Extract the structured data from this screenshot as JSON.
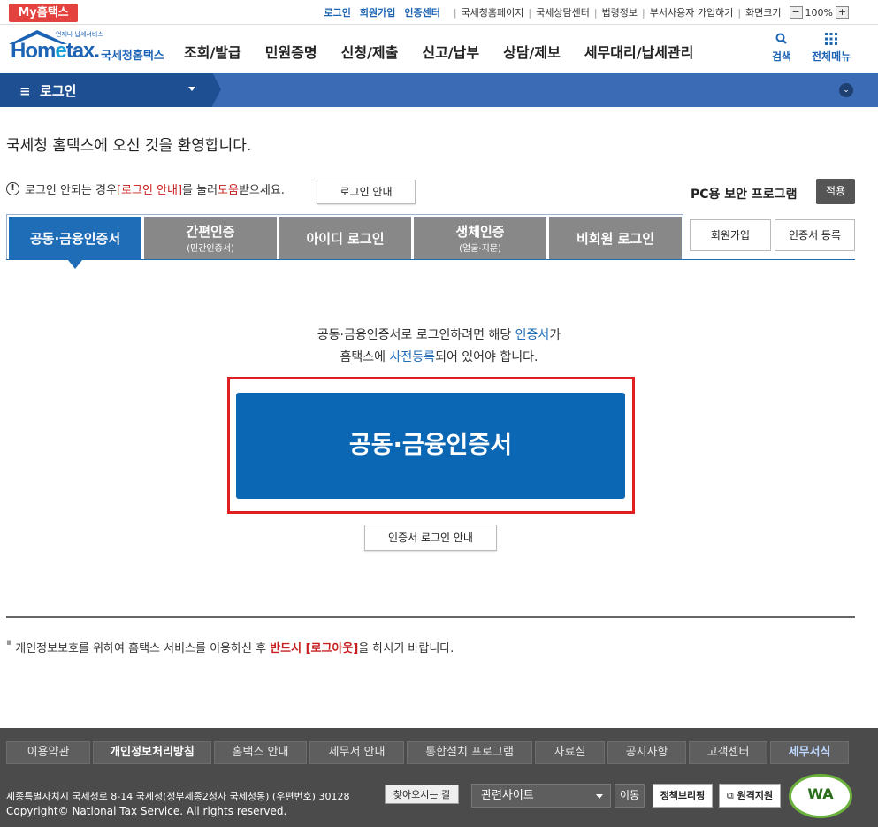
{
  "topbar": {
    "my_hometax": "My홈택스",
    "login": "로그인",
    "join": "회원가입",
    "cert_center": "인증센터",
    "links": [
      "국세청홈페이지",
      "국세상담센터",
      "법령정보",
      "부서사용자 가입하기"
    ],
    "screen_size_label": "화면크기",
    "zoom_minus": "−",
    "zoom_value": "100%",
    "zoom_plus": "+"
  },
  "header": {
    "logo_sub": "언제나 납세서비스",
    "logo_main_a": "Hom",
    "logo_main_e": "e",
    "logo_main_b": "tax.",
    "logo_kr": "국세청홈택스",
    "gnb": [
      "조회/발급",
      "민원증명",
      "신청/제출",
      "신고/납부",
      "상담/제보",
      "세무대리/납세관리"
    ],
    "search_label": "검색",
    "allmenu_label": "전체메뉴"
  },
  "navbar": {
    "menu_icon": "≡",
    "current": "로그인",
    "expand_icon": "⌄"
  },
  "main": {
    "welcome": "국세청 홈택스에 오신 것을 환영합니다.",
    "notice_a": "로그인 안되는 경우 ",
    "notice_b": "[로그인 안내]",
    "notice_c": "를 눌러 ",
    "notice_d": "도움",
    "notice_e": "받으세요.",
    "guide_button": "로그인 안내",
    "pc_security": "PC용 보안 프로그램",
    "apply_button": "적용",
    "tabs": [
      {
        "label": "공동·금융인증서",
        "sub": ""
      },
      {
        "label": "간편인증",
        "sub": "(민간인증서)"
      },
      {
        "label": "아이디 로그인",
        "sub": ""
      },
      {
        "label": "생체인증",
        "sub": "(얼굴·지문)"
      },
      {
        "label": "비회원 로그인",
        "sub": ""
      }
    ],
    "join_button": "회원가입",
    "cert_register_button": "인증서 등록",
    "info_line1_a": "공동·금융인증서로 로그인하려면 해당 ",
    "info_line1_b": "인증서",
    "info_line1_c": "가",
    "info_line2_a": "홈택스에 ",
    "info_line2_b": "사전등록",
    "info_line2_c": "되어 있어야 합니다.",
    "cert_login_button": "공동·금융인증서",
    "cert_guide_button": "인증서 로그인 안내",
    "privacy_a": "개인정보보호를 위하여 홈택스 서비스를 이용하신 후 ",
    "privacy_b": "반드시 [로그아웃]",
    "privacy_c": "을 하시기 바랍니다."
  },
  "footer": {
    "links": [
      "이용약관",
      "개인정보처리방침",
      "홈택스 안내",
      "세무서 안내",
      "통합설치 프로그램",
      "자료실",
      "공지사항",
      "고객센터",
      "세무서식"
    ],
    "address": "세종특별자치시 국세청로 8-14 국세청(정부세종2청사 국세청동) (우편번호) 30128",
    "find_button": "찾아오시는 길",
    "copyright": "Copyright© National Tax Service. All rights reserved.",
    "related_site": "관련사이트",
    "move_button": "이동",
    "briefing_button": "정책브리핑",
    "remote_button": "원격지원",
    "wa_mark": "WA"
  }
}
